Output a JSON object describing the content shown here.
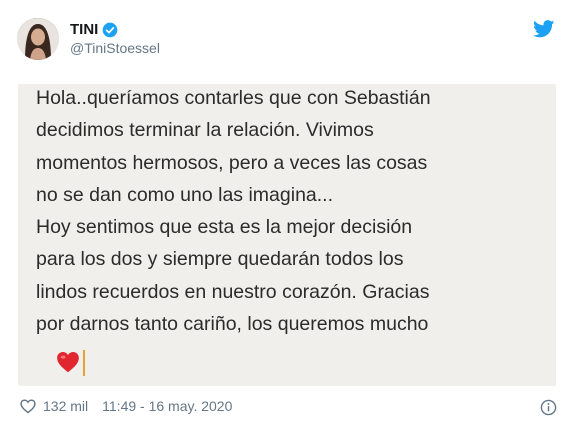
{
  "tweet": {
    "display_name": "TINI",
    "handle": "@TiniStoessel",
    "message_lines": [
      "Hola..queríamos contarles que con Sebastián",
      "decidimos terminar la relación. Vivimos",
      "momentos hermosos, pero a veces las cosas",
      "no se dan como uno las imagina...",
      "Hoy sentimos que esta es la mejor decisión",
      "para los dos y siempre quedarán todos los",
      "lindos recuerdos en nuestro corazón. Gracias",
      "por darnos tanto cariño, los queremos mucho"
    ],
    "likes": "132 mil",
    "timestamp": "11:49 - 16 may. 2020"
  },
  "icons": {
    "verified": "verified-badge-icon",
    "twitter": "twitter-bird-icon",
    "like": "heart-outline-icon",
    "info": "info-icon",
    "emoji": "red-heart-emoji"
  },
  "colors": {
    "twitter_blue": "#1da1f2",
    "message_bg": "#f1efec",
    "secondary_text": "#657786"
  }
}
